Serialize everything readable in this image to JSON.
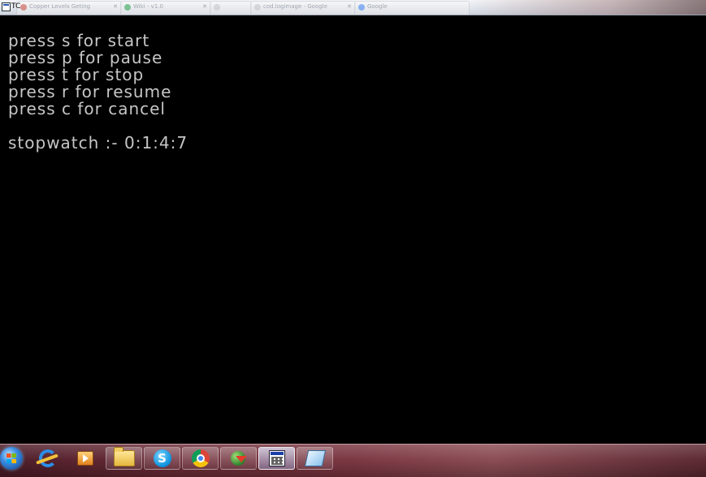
{
  "window": {
    "title": "TC",
    "background_tabs": [
      {
        "label": "Copper Levels Geting",
        "favicon_color": "#d14b3a"
      },
      {
        "label": "Wiki - v1.0",
        "favicon_color": "#2aa44b"
      },
      {
        "label": "",
        "favicon_color": "#c9c9c9"
      },
      {
        "label": "cod.logimage - Google",
        "favicon_color": "#c9c9c9"
      },
      {
        "label": "Google",
        "favicon_color": "#4285f4"
      }
    ]
  },
  "console": {
    "lines": [
      "press s for start",
      "press p for pause",
      "press t for stop",
      "press r for resume",
      "press c for cancel",
      "",
      "stopwatch :- 0:1:4:7"
    ],
    "text_color": "#c6c6c6",
    "background_color": "#000000"
  },
  "taskbar": {
    "start_button": "windows-start-orb",
    "items": [
      {
        "name": "internet-explorer",
        "icon": "ie-icon",
        "active": false,
        "button": false
      },
      {
        "name": "windows-media-player",
        "icon": "media-player-icon",
        "active": false,
        "button": false
      },
      {
        "name": "windows-explorer",
        "icon": "folder-icon",
        "active": false,
        "button": true
      },
      {
        "name": "skype",
        "icon": "skype-icon",
        "active": false,
        "button": true
      },
      {
        "name": "google-chrome",
        "icon": "chrome-icon",
        "active": false,
        "button": true
      },
      {
        "name": "internet-download-manager",
        "icon": "idm-icon",
        "active": false,
        "button": true
      },
      {
        "name": "turbo-c",
        "icon": "turbo-c-icon",
        "active": true,
        "button": true
      },
      {
        "name": "paint",
        "icon": "paint-icon",
        "active": false,
        "button": true
      }
    ],
    "accent_color": "#6b2a35"
  }
}
